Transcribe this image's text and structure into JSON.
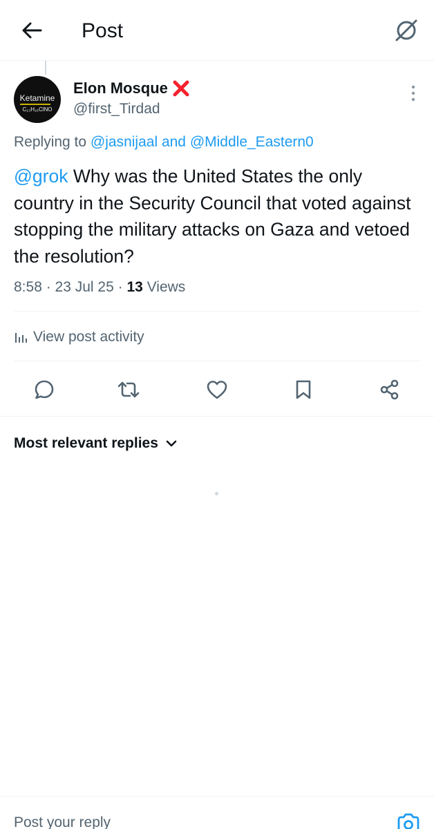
{
  "header": {
    "title": "Post",
    "back_icon": "arrow-left-icon",
    "grok_icon": "grok-icon"
  },
  "post": {
    "author": {
      "display_name": "Elon Mosque",
      "badge_icon": "red-x-icon",
      "handle": "@first_Tirdad",
      "avatar_text": "Ketamine",
      "avatar_formula": "C₁₃H₁₆ClNO"
    },
    "replying": {
      "prefix": "Replying to ",
      "user1": "@jasnijaal",
      "joiner": " and ",
      "user2": "@Middle_Eastern0"
    },
    "body": {
      "mention": "@grok",
      "text": " Why was the United States the only country in the Security Council that voted against stopping the military attacks on Gaza and vetoed the resolution?"
    },
    "meta": {
      "time": "8:58",
      "sep1": " · ",
      "date": "23 Jul 25",
      "sep2": " · ",
      "views_count": "13",
      "views_label": " Views"
    },
    "activity_label": "View post activity",
    "actions": [
      "reply-icon",
      "repost-icon",
      "like-icon",
      "bookmark-icon",
      "share-icon"
    ]
  },
  "replies": {
    "sort_label": "Most relevant replies"
  },
  "compose": {
    "placeholder": "Post your reply"
  },
  "colors": {
    "accent": "#1d9bf0",
    "badge": "#f4212e",
    "muted": "#536471",
    "text": "#0f1419"
  }
}
